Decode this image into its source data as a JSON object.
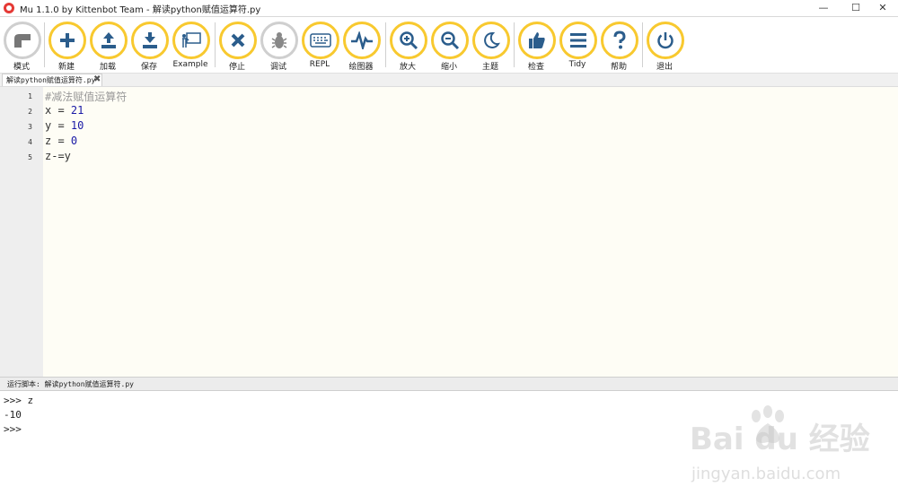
{
  "window": {
    "title": "Mu 1.1.0 by Kittenbot Team - 解读python赋值运算符.py",
    "min_glyph": "—",
    "max_glyph": "☐",
    "close_glyph": "✕"
  },
  "toolbar": {
    "buttons": [
      {
        "id": "mode",
        "label": "模式",
        "icon": "mode-icon"
      },
      {
        "id": "new",
        "label": "新建",
        "icon": "plus-icon"
      },
      {
        "id": "load",
        "label": "加载",
        "icon": "upload-icon"
      },
      {
        "id": "save",
        "label": "保存",
        "icon": "download-icon"
      },
      {
        "id": "example",
        "label": "Example",
        "icon": "presentation-icon"
      },
      {
        "id": "stop",
        "label": "停止",
        "icon": "close-icon"
      },
      {
        "id": "debug",
        "label": "调试",
        "icon": "bug-icon"
      },
      {
        "id": "repl",
        "label": "REPL",
        "icon": "keyboard-icon"
      },
      {
        "id": "plotter",
        "label": "绘图器",
        "icon": "pulse-icon"
      },
      {
        "id": "zoom-in",
        "label": "放大",
        "icon": "zoom-in-icon"
      },
      {
        "id": "zoom-out",
        "label": "缩小",
        "icon": "zoom-out-icon"
      },
      {
        "id": "theme",
        "label": "主题",
        "icon": "moon-icon"
      },
      {
        "id": "check",
        "label": "检查",
        "icon": "thumbs-up-icon"
      },
      {
        "id": "tidy",
        "label": "Tidy",
        "icon": "lines-icon"
      },
      {
        "id": "help",
        "label": "帮助",
        "icon": "question-icon"
      },
      {
        "id": "quit",
        "label": "退出",
        "icon": "power-icon"
      }
    ]
  },
  "tab": {
    "label": "解读python赋值运算符.py",
    "close_glyph": "✖"
  },
  "editor": {
    "lines": [
      {
        "n": "1",
        "text": "#减法赋值运算符"
      },
      {
        "n": "2",
        "text": "x = 21"
      },
      {
        "n": "3",
        "text": "y = 10"
      },
      {
        "n": "4",
        "text": "z = 0"
      },
      {
        "n": "5",
        "text": "z-=y"
      }
    ]
  },
  "repl": {
    "title": "运行脚本: 解读python赋值运算符.py",
    "lines": [
      ">>> z",
      "-10",
      ">>>"
    ]
  },
  "watermark": {
    "logo": "Bai  du 经验",
    "url": "jingyan.baidu.com"
  },
  "colors": {
    "accent": "#f8c92f",
    "icon": "#2b5d8c",
    "editor_bg": "#fefdf5"
  }
}
